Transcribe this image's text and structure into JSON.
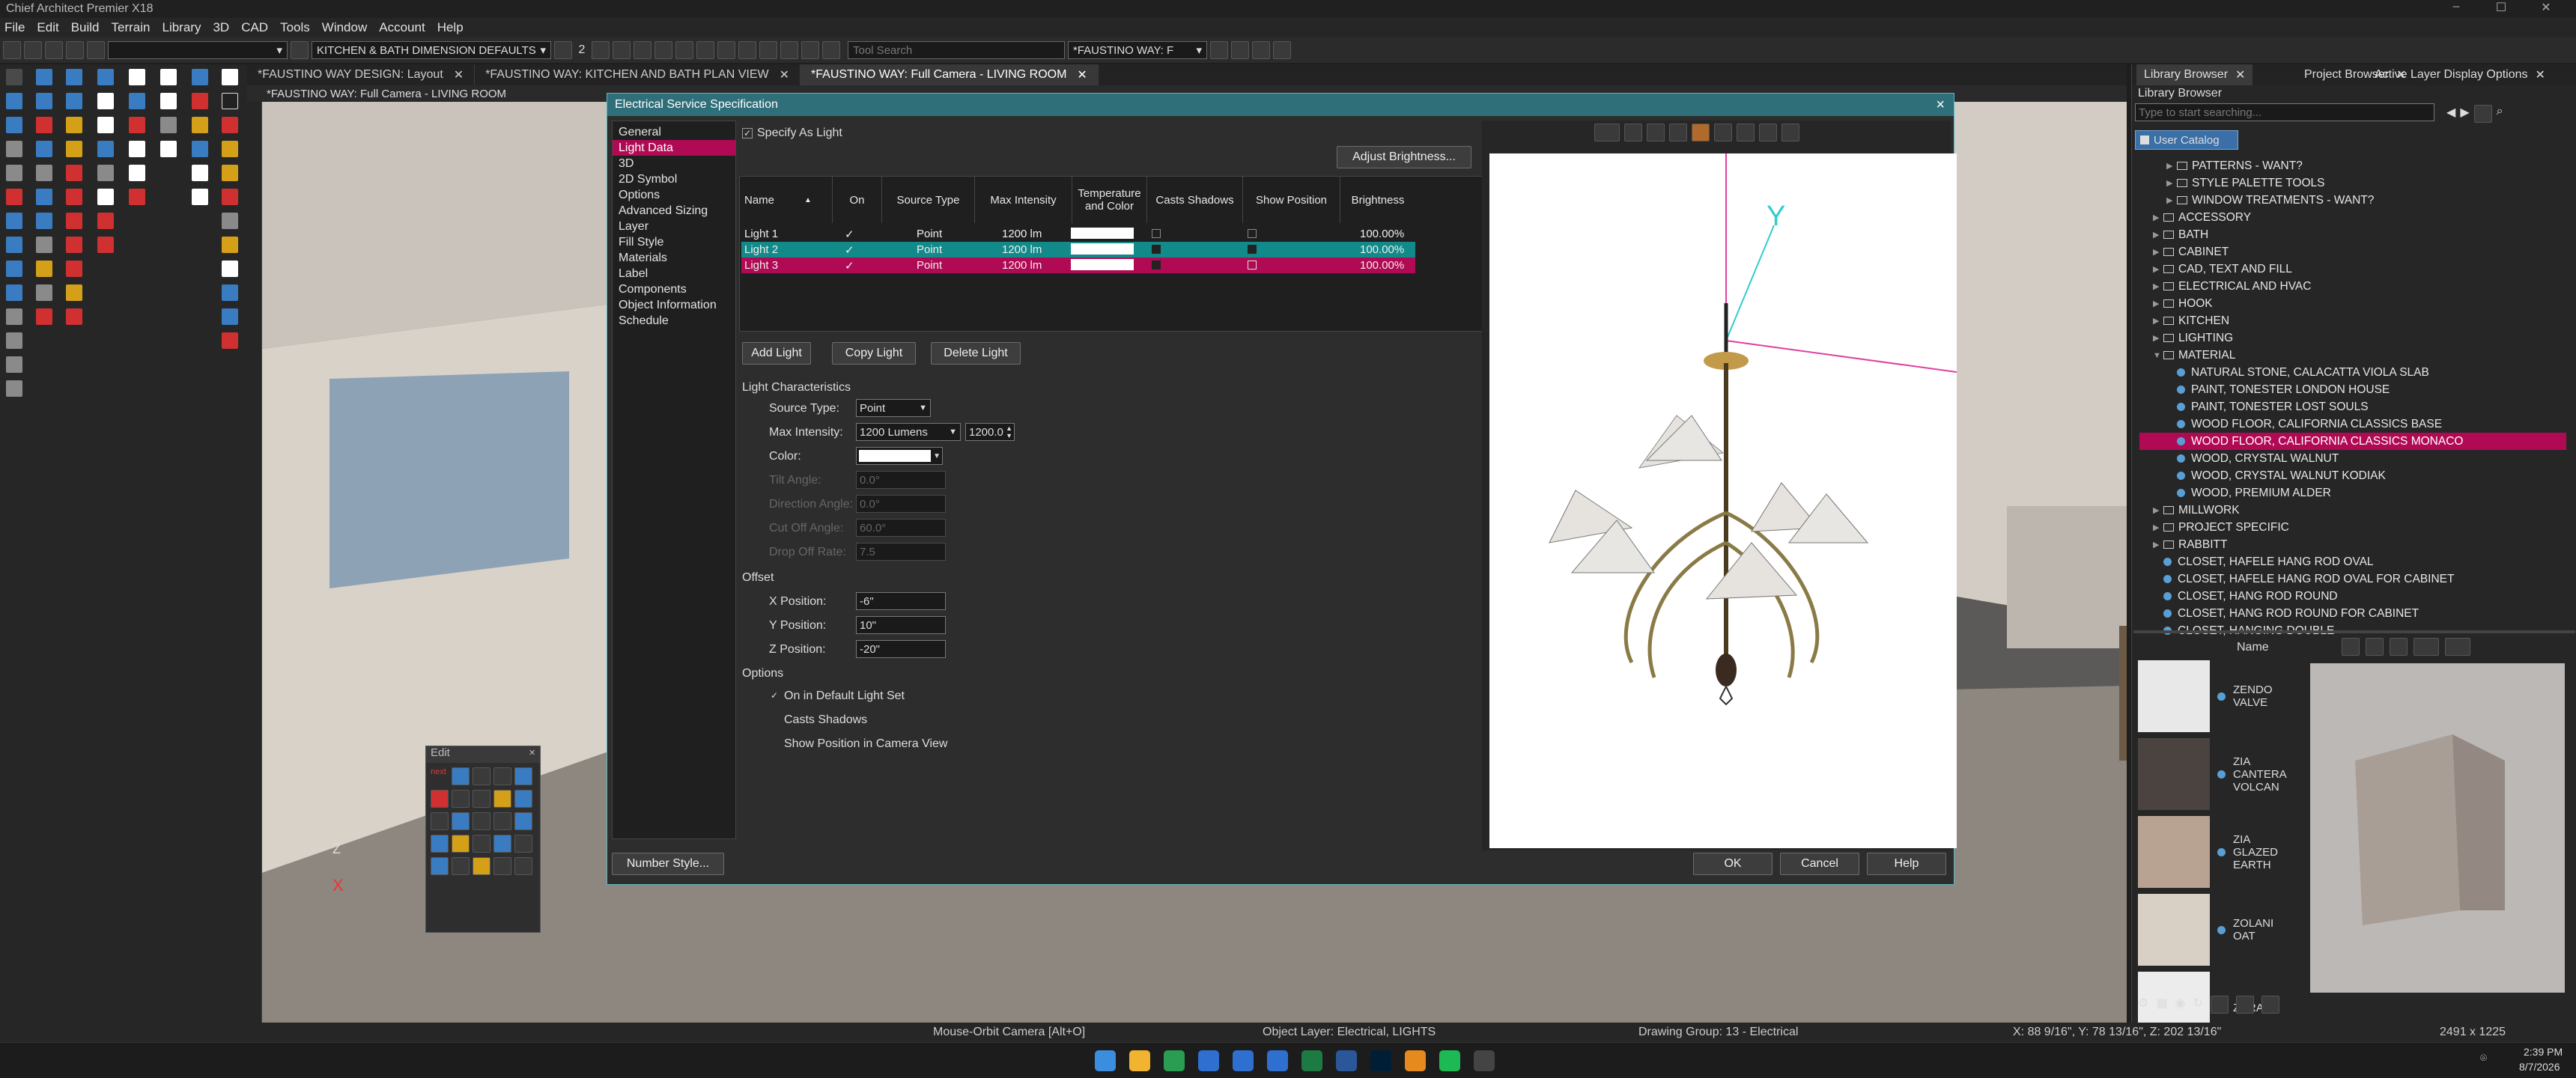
{
  "app": {
    "title": "Chief Architect Premier X18"
  },
  "menu": [
    "File",
    "Edit",
    "Build",
    "Terrain",
    "Library",
    "3D",
    "CAD",
    "Tools",
    "Window",
    "Account",
    "Help"
  ],
  "toolbar": {
    "dimension_default": "KITCHEN & BATH DIMENSION DEFAULTS",
    "floor_number": "2",
    "search_placeholder": "Tool Search",
    "layerset": "*FAUSTINO WAY: F"
  },
  "tabs": [
    {
      "label": "*FAUSTINO WAY DESIGN: Layout",
      "active": false
    },
    {
      "label": "*FAUSTINO WAY: KITCHEN AND BATH PLAN VIEW",
      "active": false
    },
    {
      "label": "*FAUSTINO WAY: Full Camera - LIVING ROOM",
      "active": true
    }
  ],
  "view_label": "*FAUSTINO WAY: Full Camera - LIVING ROOM",
  "dialog": {
    "title": "Electrical Service Specification",
    "nav": [
      "General",
      "Light Data",
      "3D",
      "2D Symbol",
      "Options",
      "Advanced Sizing",
      "Layer",
      "Fill Style",
      "Materials",
      "Label",
      "Components",
      "Object Information",
      "Schedule"
    ],
    "nav_selected": 1,
    "specify_as_light": "Specify As Light",
    "adjust_brightness": "Adjust Brightness...",
    "grid_headers": [
      "Name",
      "On",
      "Source Type",
      "Max Intensity",
      "Temperature and Color",
      "Casts Shadows",
      "Show Position",
      "Brightness"
    ],
    "lights": [
      {
        "name": "Light 1",
        "source": "Point",
        "intensity": "1200 lm",
        "brightness": "100.00%",
        "state": "normal"
      },
      {
        "name": "Light 2",
        "source": "Point",
        "intensity": "1200 lm",
        "brightness": "100.00%",
        "state": "teal"
      },
      {
        "name": "Light 3",
        "source": "Point",
        "intensity": "1200 lm",
        "brightness": "100.00%",
        "state": "magenta"
      }
    ],
    "add_light": "Add Light",
    "copy_light": "Copy Light",
    "delete_light": "Delete Light",
    "light_characteristics": "Light Characteristics",
    "source_type_label": "Source Type:",
    "source_type_value": "Point",
    "max_intensity_label": "Max Intensity:",
    "max_intensity_value": "1200 Lumens",
    "max_intensity_number": "1200.0",
    "color_label": "Color:",
    "tilt_angle_label": "Tilt Angle:",
    "tilt_angle_value": "0.0°",
    "direction_angle_label": "Direction Angle:",
    "direction_angle_value": "0.0°",
    "cut_off_label": "Cut Off Angle:",
    "cut_off_value": "60.0°",
    "drop_off_label": "Drop Off Rate:",
    "drop_off_value": "7.5",
    "offset": "Offset",
    "x_label": "X Position:",
    "x_value": "-6\"",
    "y_label": "Y Position:",
    "y_value": "10\"",
    "z_label": "Z Position:",
    "z_value": "-20\"",
    "options": "Options",
    "opt_default": "On in Default Light Set",
    "opt_shadows": "Casts Shadows",
    "opt_show": "Show Position in Camera View",
    "number_style": "Number Style...",
    "ok": "OK",
    "cancel": "Cancel",
    "help": "Help",
    "axis_label": "Y"
  },
  "edit_palette": {
    "title": "Edit",
    "next": "next"
  },
  "scene_axis": {
    "z": "Z",
    "x": "X"
  },
  "right_panel": {
    "tabs": [
      "Library Browser",
      "Project Browser",
      "Active Layer Display Options"
    ],
    "header": "Library Browser",
    "search_placeholder": "Type to start searching...",
    "catalog_label": "User Catalog",
    "tree": [
      {
        "t": "folder",
        "label": "PATTERNS - WANT?",
        "indent": 2
      },
      {
        "t": "folder",
        "label": "STYLE PALETTE TOOLS",
        "indent": 2
      },
      {
        "t": "folder",
        "label": "WINDOW TREATMENTS - WANT?",
        "indent": 2
      },
      {
        "t": "folder",
        "label": "ACCESSORY",
        "indent": 1
      },
      {
        "t": "folder",
        "label": "BATH",
        "indent": 1
      },
      {
        "t": "folder",
        "label": "CABINET",
        "indent": 1
      },
      {
        "t": "folder",
        "label": "CAD, TEXT AND FILL",
        "indent": 1
      },
      {
        "t": "folder",
        "label": "ELECTRICAL AND HVAC",
        "indent": 1
      },
      {
        "t": "folder",
        "label": "HOOK",
        "indent": 1
      },
      {
        "t": "folder",
        "label": "KITCHEN",
        "indent": 1
      },
      {
        "t": "folder",
        "label": "LIGHTING",
        "indent": 1
      },
      {
        "t": "folder-open",
        "label": "MATERIAL",
        "indent": 1
      },
      {
        "t": "item",
        "label": "NATURAL STONE, CALACATTA VIOLA SLAB",
        "indent": 2
      },
      {
        "t": "item",
        "label": "PAINT, TONESTER LONDON HOUSE",
        "indent": 2
      },
      {
        "t": "item",
        "label": "PAINT, TONESTER LOST SOULS",
        "indent": 2
      },
      {
        "t": "item",
        "label": "WOOD FLOOR, CALIFORNIA CLASSICS BASE",
        "indent": 2
      },
      {
        "t": "item",
        "label": "WOOD FLOOR, CALIFORNIA CLASSICS MONACO",
        "indent": 2,
        "sel": true
      },
      {
        "t": "item",
        "label": "WOOD, CRYSTAL WALNUT",
        "indent": 2
      },
      {
        "t": "item",
        "label": "WOOD, CRYSTAL WALNUT KODIAK",
        "indent": 2
      },
      {
        "t": "item",
        "label": "WOOD, PREMIUM ALDER",
        "indent": 2
      },
      {
        "t": "folder",
        "label": "MILLWORK",
        "indent": 1
      },
      {
        "t": "folder",
        "label": "PROJECT SPECIFIC",
        "indent": 1
      },
      {
        "t": "folder",
        "label": "RABBITT",
        "indent": 1
      },
      {
        "t": "item",
        "label": "CLOSET, HAFELE HANG ROD OVAL",
        "indent": 1
      },
      {
        "t": "item",
        "label": "CLOSET, HAFELE HANG ROD OVAL FOR CABINET",
        "indent": 1
      },
      {
        "t": "item",
        "label": "CLOSET, HANG ROD ROUND",
        "indent": 1
      },
      {
        "t": "item",
        "label": "CLOSET, HANG ROD ROUND FOR CABINET",
        "indent": 1
      },
      {
        "t": "item",
        "label": "CLOSET, HANGING DOUBLE",
        "indent": 1
      }
    ],
    "list_header": "Name",
    "list_items": [
      {
        "label": "ZENDO VALVE",
        "color": "#e8e8e8"
      },
      {
        "label": "ZIA CANTERA VOLCAN",
        "color": "#4a4340"
      },
      {
        "label": "ZIA GLAZED EARTH",
        "color": "#b8a393"
      },
      {
        "label": "ZOLANI OAT",
        "color": "#d8d0c4"
      },
      {
        "label": "ZURA",
        "color": "#ececec"
      }
    ]
  },
  "status": {
    "mode": "Mouse-Orbit Camera [Alt+O]",
    "layer": "Object Layer: Electrical, LIGHTS",
    "group": "Drawing Group: 13 - Electrical",
    "coords": "X: 88 9/16\", Y: 78 13/16\", Z: 202 13/16\"",
    "size": "2491 x 1225"
  },
  "clock": {
    "time": "2:39 PM",
    "date": "8/7/2026"
  },
  "colors": {
    "accent_teal": "#2f6f7a",
    "select_magenta": "#b00a54",
    "row_teal": "#138a8a"
  }
}
